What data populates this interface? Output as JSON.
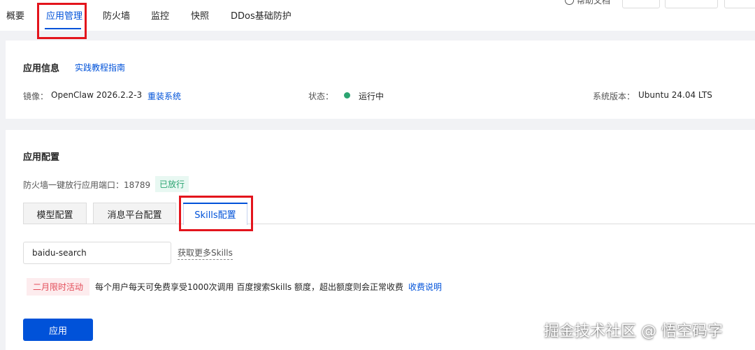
{
  "nav": {
    "tabs": [
      {
        "label": "概要"
      },
      {
        "label": "应用管理",
        "active": true
      },
      {
        "label": "防火墙"
      },
      {
        "label": "监控"
      },
      {
        "label": "快照"
      },
      {
        "label": "DDos基础防护"
      }
    ],
    "top_right_fragment": "帮助文档"
  },
  "app_info": {
    "title": "应用信息",
    "tutorial_link": "实践教程指南",
    "image_label": "镜像：",
    "image_value": "OpenClaw 2026.2.2-3",
    "reinstall_link": "重装系统",
    "status_label": "状态：",
    "status_value": "运行中",
    "os_label": "系统版本：",
    "os_value": "Ubuntu 24.04 LTS"
  },
  "app_config": {
    "title": "应用配置",
    "firewall_text": "防火墙一键放行应用端口：18789",
    "firewall_badge": "已放行",
    "subtabs": [
      {
        "label": "模型配置"
      },
      {
        "label": "消息平台配置"
      },
      {
        "label": "Skills配置",
        "active": true
      }
    ],
    "skill_input_value": "baidu-search",
    "more_skills_link": "获取更多Skills",
    "promo_badge": "二月限时活动",
    "promo_text": "每个用户每天可免费享受1000次调用 百度搜索Skills 额度，超出额度则会正常收费",
    "fee_link": "收费说明",
    "apply_button": "应用"
  },
  "watermark": "掘金技术社区 @ 悟空码字",
  "colors": {
    "accent": "#0052d9",
    "success": "#2ba471",
    "promo": "#e34d59",
    "highlight_box": "#e3141c"
  }
}
